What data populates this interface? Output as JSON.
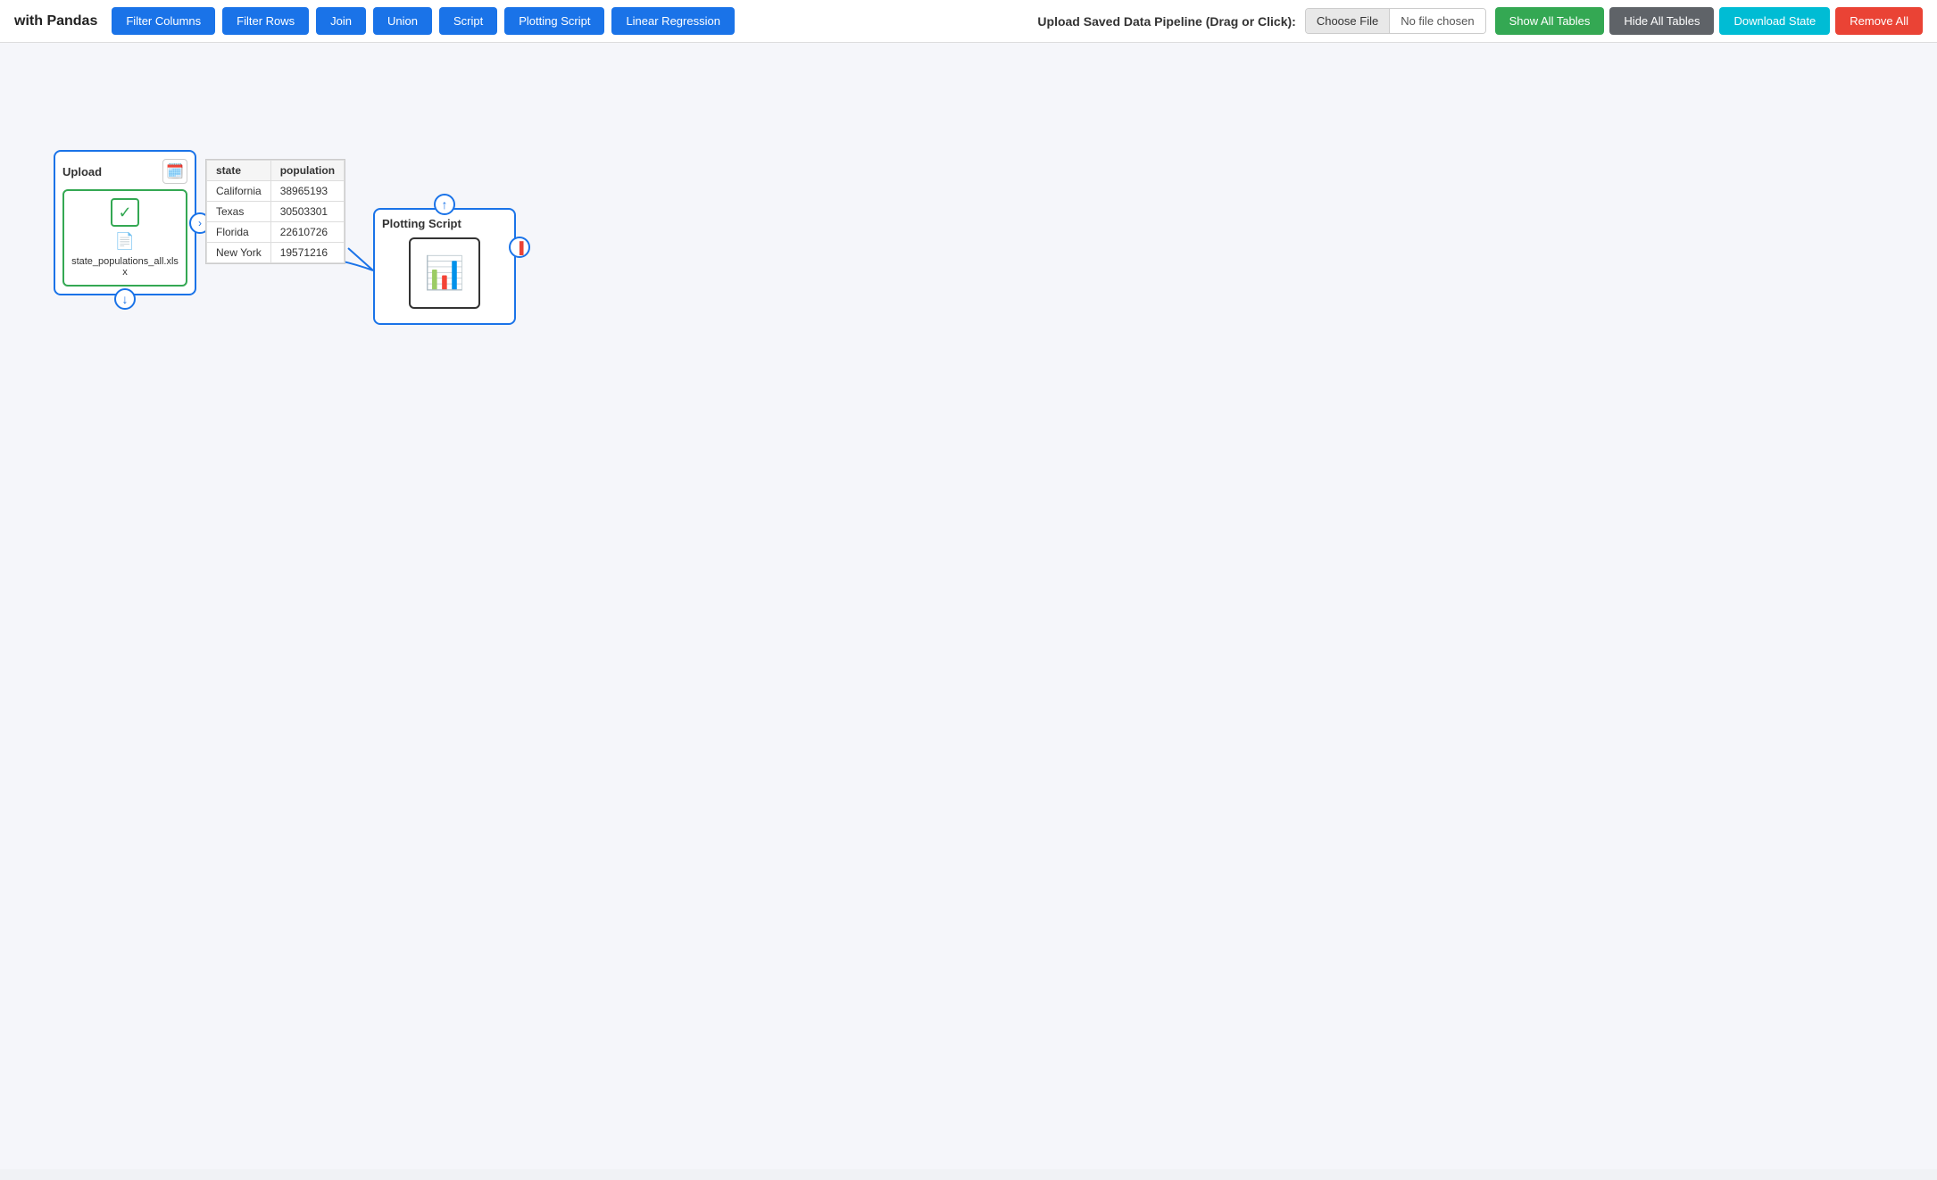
{
  "pageTitle": "with Pandas",
  "toolbar": {
    "buttons": [
      {
        "label": "Filter Columns",
        "color": "btn-blue"
      },
      {
        "label": "Filter Rows",
        "color": "btn-blue"
      },
      {
        "label": "Join",
        "color": "btn-blue"
      },
      {
        "label": "Union",
        "color": "btn-blue"
      },
      {
        "label": "Script",
        "color": "btn-blue"
      },
      {
        "label": "Plotting Script",
        "color": "btn-blue"
      },
      {
        "label": "Linear Regression",
        "color": "btn-blue"
      }
    ],
    "uploadLabel": "Upload Saved Data Pipeline (Drag or Click):",
    "chooseFileLabel": "Choose File",
    "noFileChosen": "No file chosen",
    "showAllTables": "Show All Tables",
    "hideAllTables": "Hide All Tables",
    "downloadState": "Download State",
    "removeAll": "Remove All"
  },
  "uploadNode": {
    "title": "Upload",
    "filename": "state_populations_all.xlsx"
  },
  "dataTable": {
    "columns": [
      "state",
      "population"
    ],
    "rows": [
      [
        "California",
        "38965193"
      ],
      [
        "Texas",
        "30503301"
      ],
      [
        "Florida",
        "22610726"
      ],
      [
        "New York",
        "19571216"
      ]
    ]
  },
  "plottingNode": {
    "title": "Plotting Script",
    "icon": "📊"
  }
}
